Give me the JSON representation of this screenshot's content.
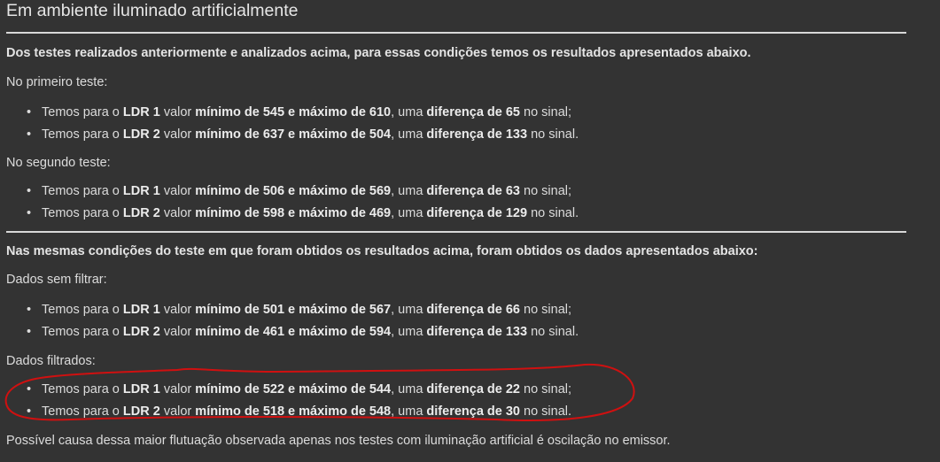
{
  "title": "Em ambiente iluminado artificialmente",
  "intro1": "Dos testes realizados anteriormente e analizados acima, para essas condições temos os resultados apresentados abaixo.",
  "first_test_label": "No primeiro teste:",
  "first_test": [
    [
      {
        "t": "Temos para o "
      },
      {
        "t": "LDR 1",
        "b": true
      },
      {
        "t": " valor "
      },
      {
        "t": "mínimo de 545 e máximo de 610",
        "b": true
      },
      {
        "t": ", uma "
      },
      {
        "t": "diferença de 65",
        "b": true
      },
      {
        "t": " no sinal;"
      }
    ],
    [
      {
        "t": "Temos para o "
      },
      {
        "t": "LDR 2",
        "b": true
      },
      {
        "t": " valor "
      },
      {
        "t": "mínimo de 637 e máximo de 504",
        "b": true
      },
      {
        "t": ", uma "
      },
      {
        "t": "diferença de 133",
        "b": true
      },
      {
        "t": " no sinal."
      }
    ]
  ],
  "second_test_label": "No segundo teste:",
  "second_test": [
    [
      {
        "t": "Temos para o "
      },
      {
        "t": "LDR 1",
        "b": true
      },
      {
        "t": " valor "
      },
      {
        "t": "mínimo de 506 e máximo de 569",
        "b": true
      },
      {
        "t": ", uma "
      },
      {
        "t": "diferença de 63",
        "b": true
      },
      {
        "t": " no sinal;"
      }
    ],
    [
      {
        "t": "Temos para o "
      },
      {
        "t": "LDR 2",
        "b": true
      },
      {
        "t": " valor "
      },
      {
        "t": "mínimo de 598 e máximo de 469",
        "b": true
      },
      {
        "t": ", uma "
      },
      {
        "t": "diferença de 129",
        "b": true
      },
      {
        "t": " no sinal."
      }
    ]
  ],
  "intro2": "Nas mesmas condições do teste em que foram obtidos os resultados acima, foram obtidos os dados apresentados abaixo:",
  "unfiltered_label": "Dados sem filtrar:",
  "unfiltered": [
    [
      {
        "t": "Temos para o "
      },
      {
        "t": "LDR 1",
        "b": true
      },
      {
        "t": " valor "
      },
      {
        "t": "mínimo de 501 e máximo de 567",
        "b": true
      },
      {
        "t": ", uma "
      },
      {
        "t": "diferença de 66",
        "b": true
      },
      {
        "t": " no sinal;"
      }
    ],
    [
      {
        "t": "Temos para o "
      },
      {
        "t": "LDR 2",
        "b": true
      },
      {
        "t": " valor "
      },
      {
        "t": "mínimo de 461 e máximo de 594",
        "b": true
      },
      {
        "t": ", uma "
      },
      {
        "t": "diferença de 133",
        "b": true
      },
      {
        "t": " no sinal."
      }
    ]
  ],
  "filtered_label": "Dados filtrados:",
  "filtered": [
    [
      {
        "t": "Temos para o "
      },
      {
        "t": "LDR 1",
        "b": true
      },
      {
        "t": " valor "
      },
      {
        "t": "mínimo de 522 e máximo de 544",
        "b": true
      },
      {
        "t": ", uma "
      },
      {
        "t": "diferença de 22",
        "b": true
      },
      {
        "t": " no sinal;"
      }
    ],
    [
      {
        "t": "Temos para o "
      },
      {
        "t": "LDR 2",
        "b": true
      },
      {
        "t": " valor "
      },
      {
        "t": "mínimo de 518 e máximo de 548",
        "b": true
      },
      {
        "t": ", uma "
      },
      {
        "t": "diferença de 30",
        "b": true
      },
      {
        "t": " no sinal."
      }
    ]
  ],
  "conclusion": "Possível causa dessa maior flutuação observada apenas nos testes com iluminação artificial é oscilação no emissor.",
  "annotation_color": "#d01010"
}
